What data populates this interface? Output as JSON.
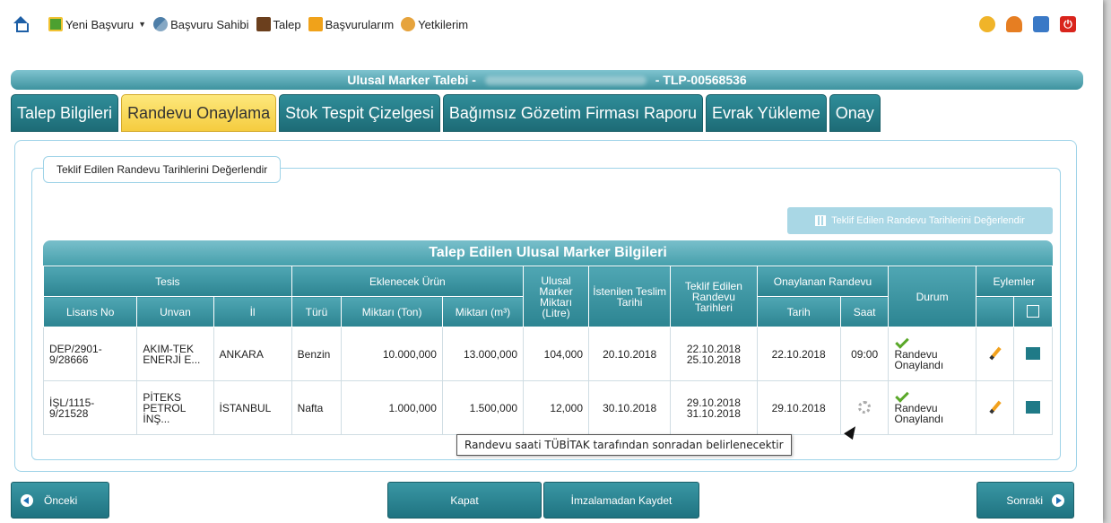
{
  "menu": {
    "new_application": "Yeni Başvuru",
    "applicant": "Başvuru Sahibi",
    "request": "Talep",
    "my_applications": "Başvurularım",
    "authorizations": "Yetkilerim"
  },
  "title": {
    "prefix": "Ulusal Marker Talebi -",
    "suffix": "- TLP-00568536"
  },
  "tabs": [
    {
      "label": "Talep Bilgileri",
      "active": false
    },
    {
      "label": "Randevu Onaylama",
      "active": true
    },
    {
      "label": "Stok Tespit Çizelgesi",
      "active": false
    },
    {
      "label": "Bağımsız Gözetim Firması Raporu",
      "active": false
    },
    {
      "label": "Evrak Yükleme",
      "active": false
    },
    {
      "label": "Onay",
      "active": false
    }
  ],
  "section": {
    "legend": "Teklif Edilen Randevu Tarihlerini Değerlendir",
    "evaluate_button": "Teklif Edilen Randevu Tarihlerini Değerlendir"
  },
  "table": {
    "title": "Talep Edilen Ulusal Marker Bilgileri",
    "group_headers": {
      "tesis": "Tesis",
      "urun": "Eklenecek Ürün",
      "marker": "Ulusal Marker Miktarı (Litre)",
      "teslim": "İstenilen Teslim Tarihi",
      "teklif": "Teklif Edilen Randevu Tarihleri",
      "onaylanan": "Onaylanan Randevu",
      "durum": "Durum",
      "eylemler": "Eylemler"
    },
    "sub_headers": {
      "lisans": "Lisans No",
      "unvan": "Unvan",
      "il": "İl",
      "turu": "Türü",
      "ton": "Miktarı (Ton)",
      "m3": "Miktarı (m³)",
      "tarih": "Tarih",
      "saat": "Saat"
    },
    "rows": [
      {
        "lisans": "DEP/2901-9/28666",
        "unvan": "AKIM-TEK ENERJİ E...",
        "il": "ANKARA",
        "turu": "Benzin",
        "ton": "10.000,000",
        "m3": "13.000,000",
        "marker": "104,000",
        "teslim": "20.10.2018",
        "teklif1": "22.10.2018",
        "teklif2": "25.10.2018",
        "tarih": "22.10.2018",
        "saat": "09:00",
        "durum": "Randevu Onaylandı"
      },
      {
        "lisans": "İŞL/1115-9/21528",
        "unvan": "PİTEKS PETROL İNŞ...",
        "il": "İSTANBUL",
        "turu": "Nafta",
        "ton": "1.000,000",
        "m3": "1.500,000",
        "marker": "12,000",
        "teslim": "30.10.2018",
        "teklif1": "29.10.2018",
        "teklif2": "31.10.2018",
        "tarih": "29.10.2018",
        "saat": "",
        "durum": "Randevu Onaylandı"
      }
    ]
  },
  "tooltip": "Randevu saati TÜBİTAK tarafından sonradan belirlenecektir",
  "buttons": {
    "prev": "Önceki",
    "close": "Kapat",
    "save_unsigned": "İmzalamadan Kaydet",
    "next": "Sonraki"
  }
}
